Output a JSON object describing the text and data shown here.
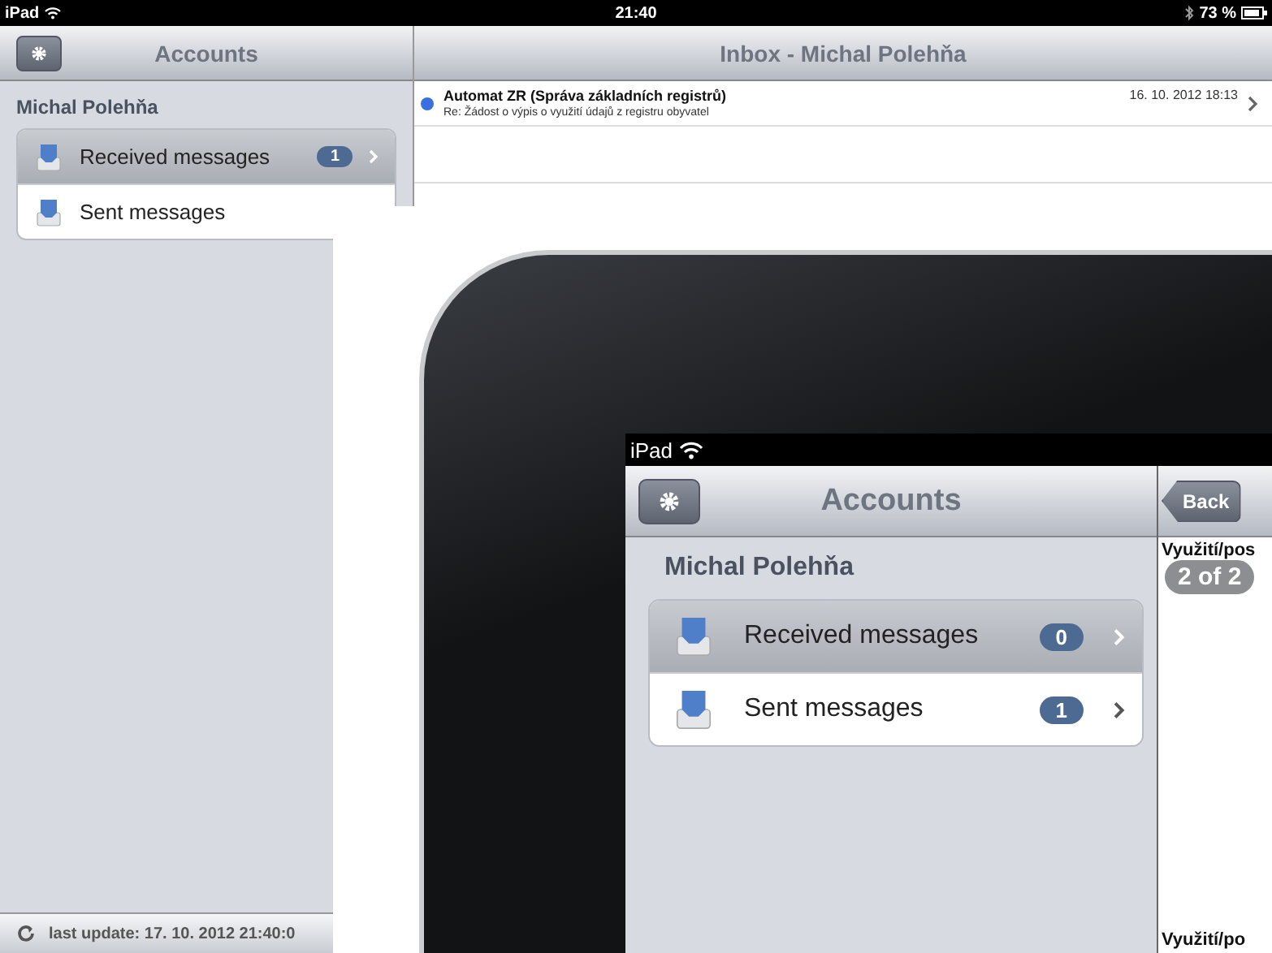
{
  "screen": {
    "status_bar": {
      "carrier": "iPad",
      "time": "21:40",
      "battery": "73 %"
    },
    "sidebar": {
      "title": "Accounts",
      "account": "Michal Polehňa",
      "folders": [
        {
          "label": "Received messages",
          "badge": "1",
          "selected": true
        },
        {
          "label": "Sent messages",
          "selected": false
        }
      ],
      "footer": "last update: 17. 10. 2012 21:40:0"
    },
    "inbox": {
      "title": "Inbox - Michal Polehňa",
      "messages": [
        {
          "sender": "Automat ZR (Správa základních registrů)",
          "subject": "Re: Žádost o výpis o využití údajů z registru obyvatel",
          "date": "16. 10. 2012 18:13",
          "unread": true
        }
      ]
    }
  },
  "inset_tablet": {
    "status_bar": {
      "carrier": "iPad"
    },
    "sidebar": {
      "title": "Accounts",
      "account": "Michal Polehňa",
      "folders": [
        {
          "label": "Received messages",
          "badge": "0",
          "selected": true
        },
        {
          "label": "Sent messages",
          "badge": "1",
          "selected": false
        }
      ]
    },
    "detail": {
      "back_button": "Back",
      "subject": "Využití/pos",
      "counter": "2 of 2",
      "bottom_subject": "Využití/po"
    }
  }
}
